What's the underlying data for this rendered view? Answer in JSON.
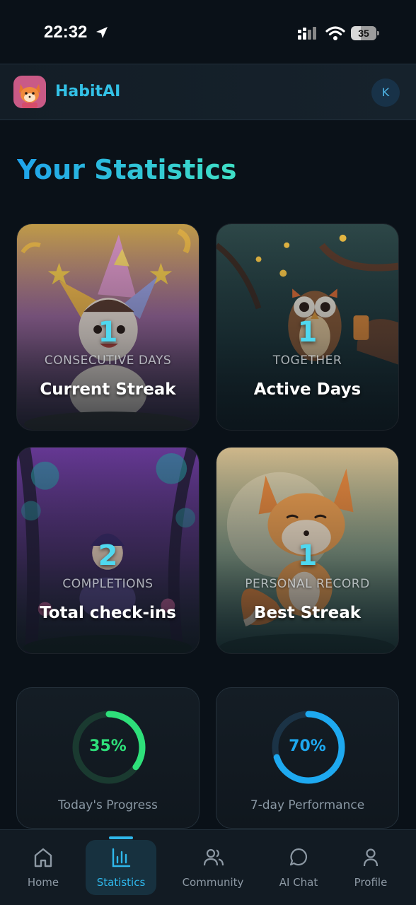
{
  "status_bar": {
    "time": "22:32",
    "battery": "35"
  },
  "header": {
    "app_name": "HabitAI",
    "avatar_initial": "K"
  },
  "page": {
    "title": "Your Statistics"
  },
  "stats": [
    {
      "value": "1",
      "caption": "CONSECUTIVE DAYS",
      "label": "Current Streak"
    },
    {
      "value": "1",
      "caption": "TOGETHER",
      "label": "Active Days"
    },
    {
      "value": "2",
      "caption": "COMPLETIONS",
      "label": "Total check-ins"
    },
    {
      "value": "1",
      "caption": "PERSONAL RECORD",
      "label": "Best Streak"
    }
  ],
  "progress": [
    {
      "value_text": "35%",
      "fraction": 0.35,
      "label": "Today's Progress",
      "color": "#2ee07a"
    },
    {
      "value_text": "70%",
      "fraction": 0.7,
      "label": "7-day Performance",
      "color": "#1ea9f0"
    }
  ],
  "nav": [
    {
      "label": "Home",
      "icon": "home-icon"
    },
    {
      "label": "Statistics",
      "icon": "bar-chart-icon"
    },
    {
      "label": "Community",
      "icon": "users-icon"
    },
    {
      "label": "AI Chat",
      "icon": "chat-bubble-icon"
    },
    {
      "label": "Profile",
      "icon": "user-icon"
    }
  ]
}
